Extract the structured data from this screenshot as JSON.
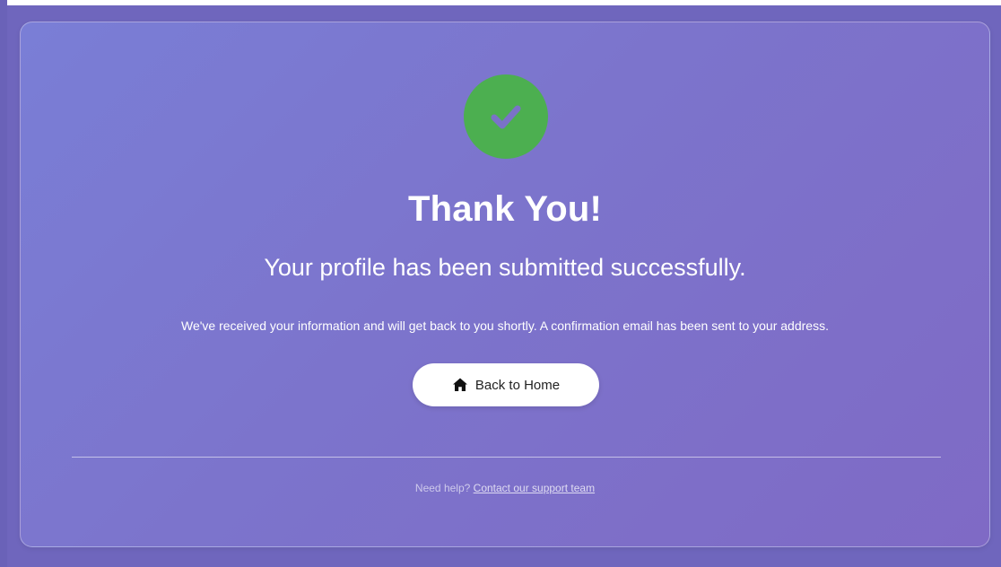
{
  "confirmation": {
    "title": "Thank You!",
    "subtitle": "Your profile has been submitted successfully.",
    "message": "We've received your information and will get back to you shortly. A confirmation email has been sent to your address.",
    "icon": "check-circle-icon",
    "icon_color": "#4caf50"
  },
  "actions": {
    "home_label": "Back to Home",
    "home_icon": "home-icon"
  },
  "footer": {
    "help_text": "Need help?",
    "support_link": "Contact our support team"
  },
  "colors": {
    "background_start": "#7a7ed6",
    "background_end": "#7f6ac5",
    "button_bg": "#ffffff"
  }
}
